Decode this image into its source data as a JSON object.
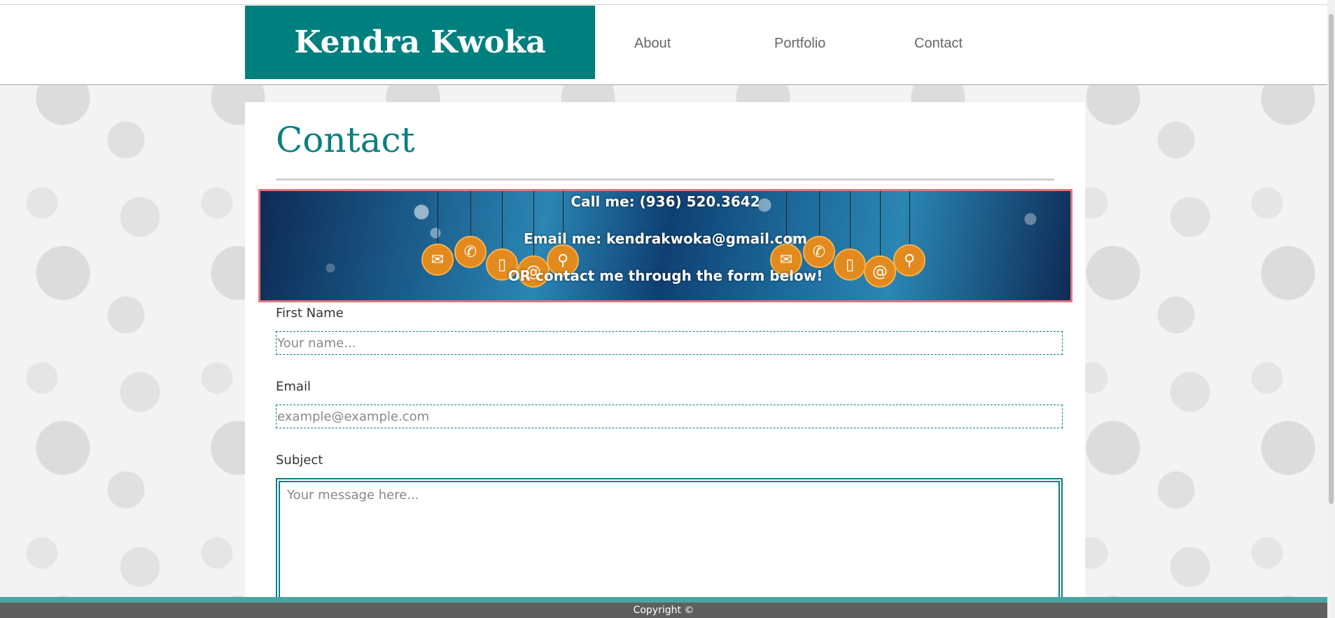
{
  "header": {
    "brand": "Kendra Kwoka",
    "nav": [
      "About",
      "Portfolio",
      "Contact"
    ]
  },
  "main": {
    "title": "Contact",
    "banner": {
      "call": "Call me: (936) 520.3642",
      "email": "Email me: kendrakwoka@gmail.com",
      "form_hint": "OR contact me through the form below!"
    },
    "form": {
      "first_name_label": "First Name",
      "first_name_placeholder": "Your name...",
      "email_label": "Email",
      "email_placeholder": "example@example.com",
      "subject_label": "Subject",
      "subject_placeholder": "Your message here..."
    }
  },
  "footer": {
    "text": "Copyright ©"
  },
  "colors": {
    "brand": "#007f7f",
    "accent_border": "#e2757b",
    "footer": "#5f5f5f",
    "footer_top": "#4aa5a5"
  },
  "icons": [
    "mail-icon",
    "phone-icon",
    "mobile-icon",
    "at-icon",
    "location-pin-icon"
  ]
}
